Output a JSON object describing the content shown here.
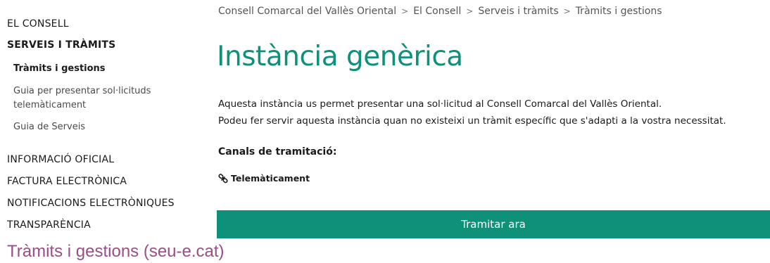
{
  "sidebar": {
    "el_consell": "EL CONSELL",
    "serveis": "SERVEIS I TRÀMITS",
    "sub_items": [
      "Tràmits i gestions",
      "Guia per presentar sol·licituds",
      "telemàticament",
      "Guia de Serveis"
    ],
    "informacio": "INFORMACIÓ OFICIAL",
    "factura": "FACTURA ELECTRÒNICA",
    "notificacions": "NOTIFICACIONS ELECTRÒNIQUES",
    "transparencia": "TRANSPARÈNCIA"
  },
  "breadcrumb": {
    "items": [
      "Consell Comarcal del Vallès Oriental",
      "El Consell",
      "Serveis i tràmits",
      "Tràmits i gestions"
    ],
    "separator": ">"
  },
  "main": {
    "title": "Instància genèrica",
    "desc_line1": "Aquesta instància us permet presentar una sol·licitud al Consell Comarcal del Vallès Oriental.",
    "desc_line2": "Podeu fer servir aquesta instància quan no existeixi un tràmit específic que s'adapti a la vostra necessitat.",
    "channels_heading": "Canals de tramitació:",
    "channel_link": "Telemàticament",
    "channel_icon": "link-icon",
    "button_label": "Tramitar ara"
  },
  "caption": "Tràmits i gestions (seu-e.cat)",
  "colors": {
    "accent": "#0f9079",
    "caption": "#9a4e86"
  }
}
